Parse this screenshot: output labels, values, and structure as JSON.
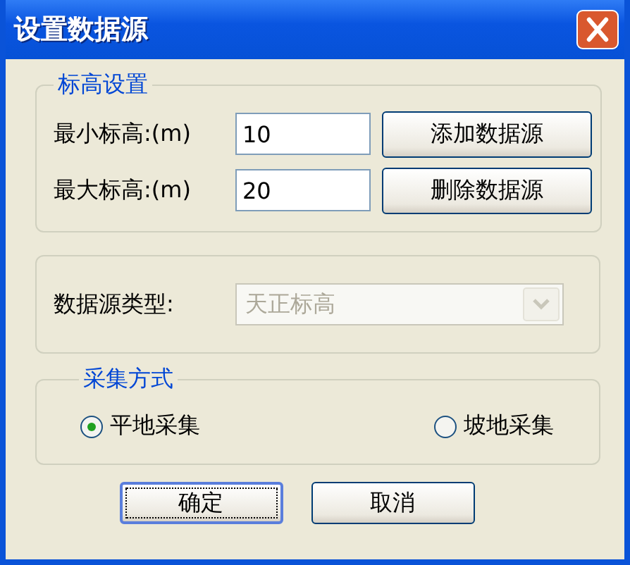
{
  "window": {
    "title": "设置数据源"
  },
  "elevation_group": {
    "title": "标高设置",
    "fields": [
      {
        "label": "最小标高:(m)",
        "value": "10",
        "button": "添加数据源"
      },
      {
        "label": "最大标高:(m)",
        "value": "20",
        "button": "删除数据源"
      }
    ]
  },
  "source_type": {
    "label": "数据源类型:",
    "value": "天正标高",
    "disabled": true
  },
  "collection": {
    "title": "采集方式",
    "options": [
      {
        "label": "平地采集",
        "selected": true
      },
      {
        "label": "坡地采集",
        "selected": false
      }
    ]
  },
  "buttons": [
    {
      "label": "确定",
      "default": true
    },
    {
      "label": "取消",
      "default": false
    }
  ]
}
